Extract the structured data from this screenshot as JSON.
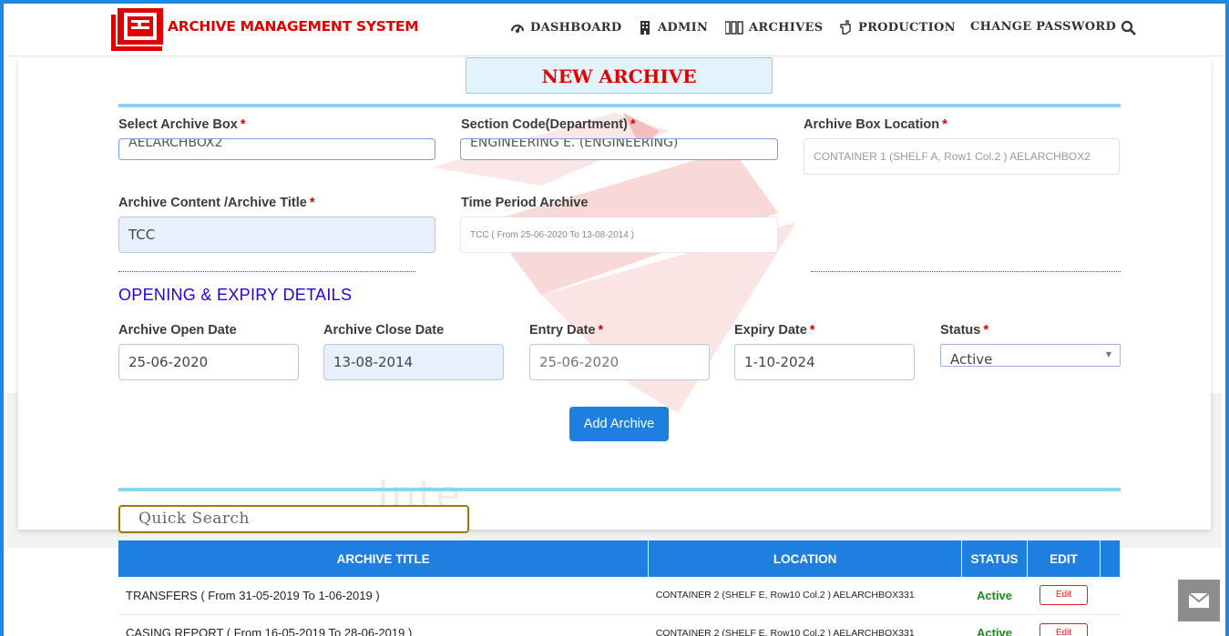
{
  "app": {
    "name": "ARCHIVE MANAGEMENT SYSTEM"
  },
  "nav": {
    "dashboard": "DASHBOARD",
    "admin": "ADMIN",
    "archives": "ARCHIVES",
    "production": "PRODUCTION",
    "change_password": "CHANGE PASSWORD"
  },
  "page": {
    "title": "NEW ARCHIVE",
    "watermark": "Inte"
  },
  "form": {
    "archive_box": {
      "label": "Select Archive Box",
      "value": "AELARCHBOX2"
    },
    "section_code": {
      "label": "Section Code(Department)",
      "value": "ENGINEERING E. (ENGINEERING)"
    },
    "box_location": {
      "label": "Archive Box Location",
      "value": "CONTAINER 1 (SHELF A, Row1 Col.2 ) AELARCHBOX2"
    },
    "content_title": {
      "label": "Archive Content /Archive Title",
      "value": "TCC"
    },
    "time_period": {
      "label": "Time Period Archive",
      "value": "TCC ( From 25-06-2020 To 13-08-2014 )"
    },
    "required_marker": "*"
  },
  "details": {
    "section_title": "OPENING & EXPIRY DETAILS",
    "open_date": {
      "label": "Archive Open Date",
      "value": "25-06-2020"
    },
    "close_date": {
      "label": "Archive Close Date",
      "value": "13-08-2014"
    },
    "entry_date": {
      "label": "Entry Date",
      "value": "25-06-2020"
    },
    "expiry_date": {
      "label": "Expiry Date",
      "value": "1-10-2024"
    },
    "status": {
      "label": "Status",
      "value": "Active"
    }
  },
  "actions": {
    "add_archive": "Add Archive"
  },
  "search": {
    "placeholder": "Quick Search"
  },
  "table": {
    "headers": [
      "ARCHIVE TITLE",
      "LOCATION",
      "STATUS",
      "EDIT"
    ],
    "rows": [
      {
        "title": "TRANSFERS ( From 31-05-2019 To 1-06-2019 )",
        "location": "CONTAINER 2 (SHELF E, Row10 Col.2 ) AELARCHBOX331",
        "status": "Active",
        "edit": "Edit"
      },
      {
        "title": "CASING REPORT ( From 16-05-2019 To 28-06-2019 )",
        "location": "CONTAINER 2 (SHELF E, Row10 Col.2 ) AELARCHBOX331",
        "status": "Active",
        "edit": "Edit"
      }
    ]
  },
  "colors": {
    "brand_red": "#e00000",
    "primary_blue": "#1e7fe0",
    "active_green": "#1c8c1c",
    "section_purple": "#2400e0"
  },
  "icons": [
    "dashboard-icon",
    "building-icon",
    "archive-boxes-icon",
    "hand-pointer-icon",
    "search-icon",
    "mail-icon"
  ]
}
